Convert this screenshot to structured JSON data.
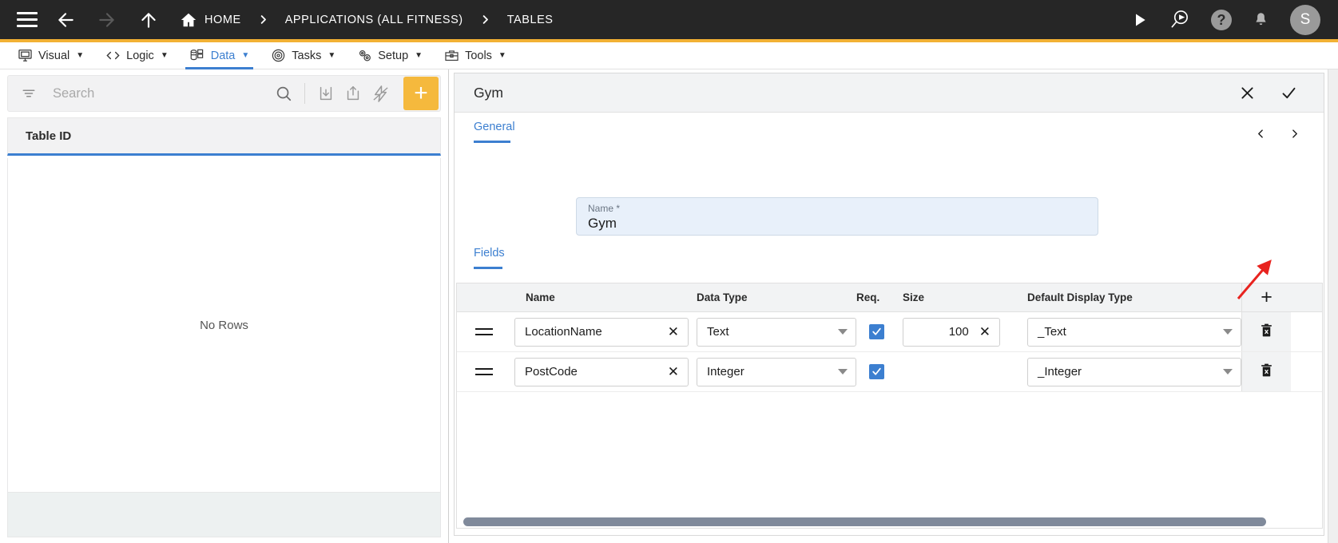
{
  "topbar": {
    "menu_icon": "hamburger-icon",
    "back_icon": "arrow-left-icon",
    "forward_icon": "arrow-right-icon",
    "up_icon": "arrow-up-icon",
    "home_icon": "home-icon",
    "breadcrumbs": [
      {
        "label": "HOME"
      },
      {
        "label": "APPLICATIONS (ALL FITNESS)"
      },
      {
        "label": "TABLES"
      }
    ],
    "separator": "chevron-right-icon",
    "actions": {
      "run_label": "play-icon",
      "find_label": "search-run-icon",
      "help_label": "?",
      "notifications_label": "bell-icon",
      "avatar_initial": "S"
    },
    "accent_color": "#f2b134",
    "background_color": "#262626"
  },
  "menubar": {
    "items": [
      {
        "label": "Visual",
        "icon": "monitor-icon",
        "caret": "▼",
        "active": false
      },
      {
        "label": "Logic",
        "icon": "code-icon",
        "caret": "▼",
        "active": false
      },
      {
        "label": "Data",
        "icon": "database-icon",
        "caret": "▼",
        "active": true
      },
      {
        "label": "Tasks",
        "icon": "target-icon",
        "caret": "▼",
        "active": false
      },
      {
        "label": "Setup",
        "icon": "gears-icon",
        "caret": "▼",
        "active": false
      },
      {
        "label": "Tools",
        "icon": "toolbox-icon",
        "caret": "▼",
        "active": false
      }
    ],
    "active_color": "#3c7fd0"
  },
  "sidebar": {
    "search": {
      "placeholder": "Search",
      "value": "",
      "filter_icon": "filter-icon",
      "search_icon": "magnifier-icon"
    },
    "toolbar": {
      "import_icon": "import-download-icon",
      "export_icon": "export-upload-icon",
      "quick_icon": "lightning-bolt-icon",
      "add_label": "+",
      "add_color": "#f5b93d"
    },
    "grid": {
      "columns": [
        "Table ID"
      ],
      "rows": [],
      "empty_message": "No Rows"
    }
  },
  "detail": {
    "title": "Gym",
    "close_label": "close-icon",
    "confirm_label": "check-icon",
    "tab": "General",
    "pager": {
      "prev": "chevron-left-icon",
      "next": "chevron-right-icon"
    },
    "name_field": {
      "label": "Name *",
      "value": "Gym"
    },
    "fields_section": {
      "tab_label": "Fields",
      "add_row_label": "+",
      "columns": [
        "Name",
        "Data Type",
        "Req.",
        "Size",
        "Default Display Type"
      ],
      "rows": [
        {
          "drag": "drag-handle-icon",
          "name": "LocationName",
          "name_clear": "✕",
          "data_type": "Text",
          "required": true,
          "size": "100",
          "size_clear": "✕",
          "default_display_type": "_Text",
          "delete": "trash-icon"
        },
        {
          "drag": "drag-handle-icon",
          "name": "PostCode",
          "name_clear": "✕",
          "data_type": "Integer",
          "required": true,
          "size": "",
          "size_clear": "",
          "default_display_type": "_Integer",
          "delete": "trash-icon"
        }
      ]
    }
  },
  "annotation": {
    "arrow_color": "#e8231f",
    "points_to": "add-field-button"
  }
}
